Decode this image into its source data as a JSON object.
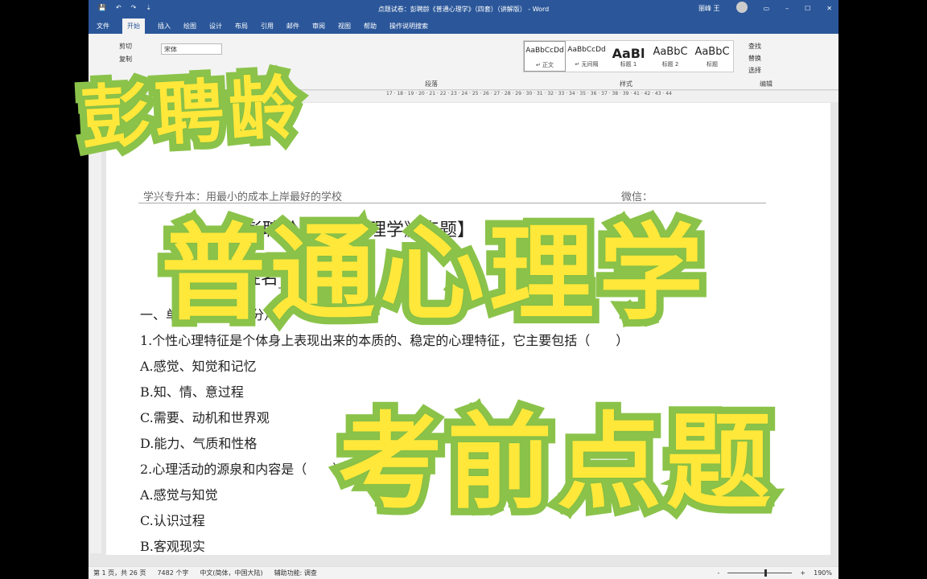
{
  "window": {
    "title": "点题试卷：彭聘龄《普通心理学》（四套）（讲解版） - Word",
    "user": "丽峰 王",
    "controls": [
      "▭",
      "–",
      "☐",
      "✕"
    ]
  },
  "quick_access": [
    "💾",
    "↶",
    "↷",
    "⇣"
  ],
  "tabs": [
    "文件",
    "开始",
    "插入",
    "绘图",
    "设计",
    "布局",
    "引用",
    "邮件",
    "审阅",
    "视图",
    "帮助",
    "操作说明搜索"
  ],
  "ribbon": {
    "cut": "剪切",
    "copy": "复制",
    "font": "宋体",
    "paragraph_label": "段落",
    "styles_label": "样式",
    "editing_label": "编辑",
    "styles": [
      {
        "preview": "AaBbCcDd",
        "name": "↵ 正文"
      },
      {
        "preview": "AaBbCcDd",
        "name": "↵ 无间隔"
      },
      {
        "preview": "AaBl",
        "name": "标题 1"
      },
      {
        "preview": "AaBbC",
        "name": "标题 2"
      },
      {
        "preview": "AaBbC",
        "name": "标题"
      }
    ],
    "find": "查找",
    "replace": "替换",
    "select": "选择"
  },
  "ruler": "17 · 18 · 19 · 20 · 21 · 22 · 23 · 24 · 25 · 26 · 27 · 28 · 29 · 30 · 31 · 32 · 33 · 34 · 35 · 36 · 37 · 38 · 39 · 41 · 42 · 43 · 44",
  "document": {
    "header_left": "学兴专升本：用最小的成本上岸最好的学校",
    "header_right": "微信：",
    "lines": [
      "【彭聘龄《普通心理学》点题】",
      "姓名________",
      "一、单选题（每题2分）",
      "1.个性心理特征是个体身上表现出来的本质的、稳定的心理特征，它主要包括（　　）",
      "A.感觉、知觉和记忆",
      "B.知、情、意过程",
      "C.需要、动机和世界观",
      "D.能力、气质和性格",
      "2.心理活动的源泉和内容是（　　）",
      "A.感觉与知觉",
      "C.认识过程",
      "B.客观现实"
    ]
  },
  "overlay": {
    "line1": "彭聘龄",
    "line2": "普通心理学",
    "line3": "考前点题",
    "fill": "#ffe83a",
    "stroke": "#8bc34a"
  },
  "status": {
    "page": "第 1 页，共 26 页",
    "words": "7482 个字",
    "language": "中文(简体，中国大陆)",
    "accessibility": "辅助功能: 调查",
    "zoom": "190%"
  }
}
